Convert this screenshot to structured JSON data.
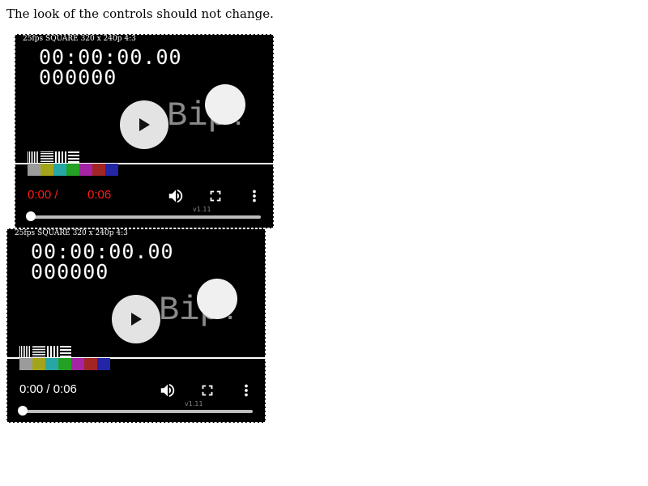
{
  "page": {
    "note": "The look of the controls should not change."
  },
  "players": [
    {
      "info": "25fps SQUARE 320 x 240p 4:3",
      "timecode": "00:00:00.00",
      "frame_count": "000000",
      "overlay_text": "Bip!",
      "current_time": "0:00 /",
      "duration": "0:06",
      "time_color": "#ff1a1a",
      "version": "v1.11",
      "progress_fraction": 0.0,
      "icons": {
        "play": "play-icon",
        "volume": "volume-icon",
        "fullscreen": "fullscreen-icon",
        "more": "more-vert-icon"
      }
    },
    {
      "info": "25fps SQUARE 320 x 240p 4:3",
      "timecode": "00:00:00.00",
      "frame_count": "000000",
      "overlay_text": "Bip!",
      "current_time": "0:00 / 0:06",
      "time_color": "#ffffff",
      "version": "v1.11",
      "progress_fraction": 0.0,
      "icons": {
        "play": "play-icon",
        "volume": "volume-icon",
        "fullscreen": "fullscreen-icon",
        "more": "more-vert-icon"
      }
    }
  ],
  "colors": {
    "test_bars": [
      "#9b9b9b",
      "#a4a41a",
      "#27a6a6",
      "#24a124",
      "#a424a4",
      "#a32424",
      "#2424a6"
    ]
  }
}
